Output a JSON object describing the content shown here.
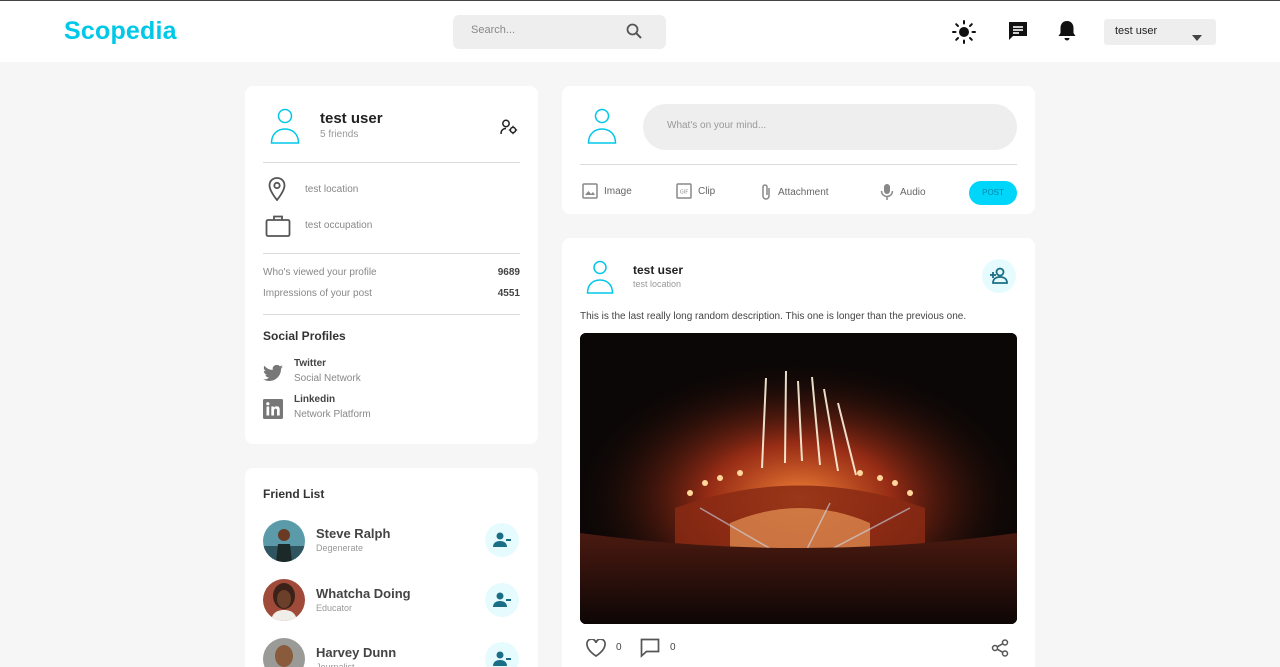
{
  "header": {
    "logo": "Scopedia",
    "search_placeholder": "Search...",
    "user_menu_label": "test user",
    "accent_color": "#00c8e8"
  },
  "profile": {
    "name": "test user",
    "friends": "5 friends",
    "location": "test location",
    "occupation": "test occupation",
    "stats": [
      {
        "label": "Who's viewed your profile",
        "value": "9689"
      },
      {
        "label": "Impressions of your post",
        "value": "4551"
      }
    ],
    "social_title": "Social Profiles",
    "socials": [
      {
        "name": "Twitter",
        "type": "Social Network",
        "icon": "twitter-icon"
      },
      {
        "name": "Linkedin",
        "type": "Network Platform",
        "icon": "linkedin-icon"
      }
    ]
  },
  "friend_list": {
    "title": "Friend List",
    "friends": [
      {
        "name": "Steve Ralph",
        "role": "Degenerate"
      },
      {
        "name": "Whatcha Doing",
        "role": "Educator"
      },
      {
        "name": "Harvey Dunn",
        "role": "Journalist"
      }
    ]
  },
  "composer": {
    "placeholder": "What's on your mind...",
    "actions": [
      "Image",
      "Clip",
      "Attachment",
      "Audio"
    ],
    "post_label": "POST"
  },
  "post": {
    "author": "test user",
    "location": "test location",
    "description": "This is the last really long random description. This one is longer than the previous one.",
    "likes": "0",
    "comments": "0"
  }
}
